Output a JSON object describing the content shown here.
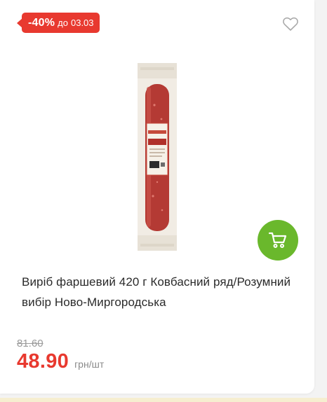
{
  "badge": {
    "discount": "-40%",
    "until_label": "до",
    "until_date": "03.03"
  },
  "product": {
    "title": "Виріб фаршевий 420 г Ковбасний ряд/Розумний вибір Ново-Миргородська",
    "old_price": "81.60",
    "price": "48.90",
    "unit": "грн/шт"
  },
  "icons": {
    "favorite": "heart-outline-icon",
    "cart": "shopping-cart-icon"
  },
  "colors": {
    "accent_red": "#e8392f",
    "cart_green": "#6ab82c",
    "old_price_gray": "#9b9b9b"
  }
}
